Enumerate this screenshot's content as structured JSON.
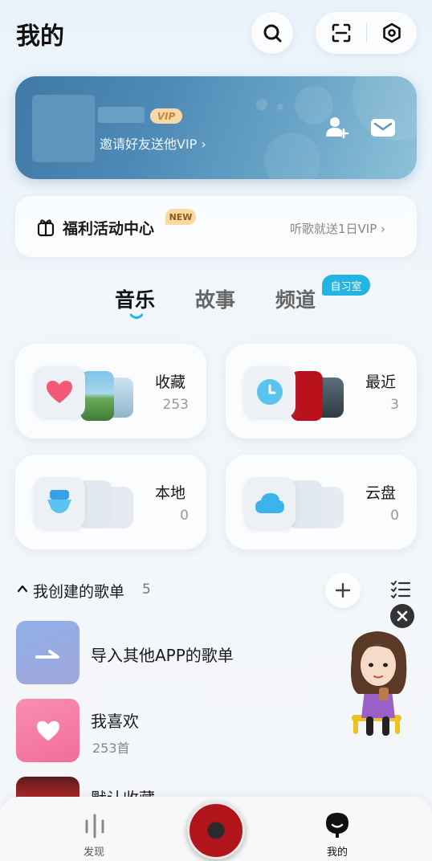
{
  "header": {
    "title": "我的"
  },
  "profile": {
    "vip_label": "VIP",
    "invite_text": "邀请好友送他VIP ›"
  },
  "benefits": {
    "title": "福利活动中心",
    "badge": "NEW",
    "subtitle": "听歌就送1日VIP ›"
  },
  "tabs": [
    {
      "label": "音乐",
      "active": true
    },
    {
      "label": "故事",
      "active": false
    },
    {
      "label": "频道",
      "active": false
    }
  ],
  "tab_badge": "自习室",
  "library": [
    {
      "label": "收藏",
      "count": "253",
      "icon": "heart-icon"
    },
    {
      "label": "最近",
      "count": "3",
      "icon": "clock-icon"
    },
    {
      "label": "本地",
      "count": "0",
      "icon": "local-music-icon"
    },
    {
      "label": "云盘",
      "count": "0",
      "icon": "cloud-icon"
    }
  ],
  "playlists_header": {
    "label": "我创建的歌单",
    "count": "5"
  },
  "playlists": [
    {
      "title": "导入其他APP的歌单",
      "subtitle": ""
    },
    {
      "title": "我喜欢",
      "subtitle": "253首"
    },
    {
      "title": "默认收藏",
      "subtitle": ""
    }
  ],
  "bottom_nav": [
    {
      "label": "发现",
      "icon": "discover-icon"
    },
    {
      "label": "我的",
      "icon": "mine-icon"
    }
  ],
  "colors": {
    "accent": "#23b4e4",
    "profile_card": "#4f8ab6",
    "heart": "#f25a78"
  }
}
